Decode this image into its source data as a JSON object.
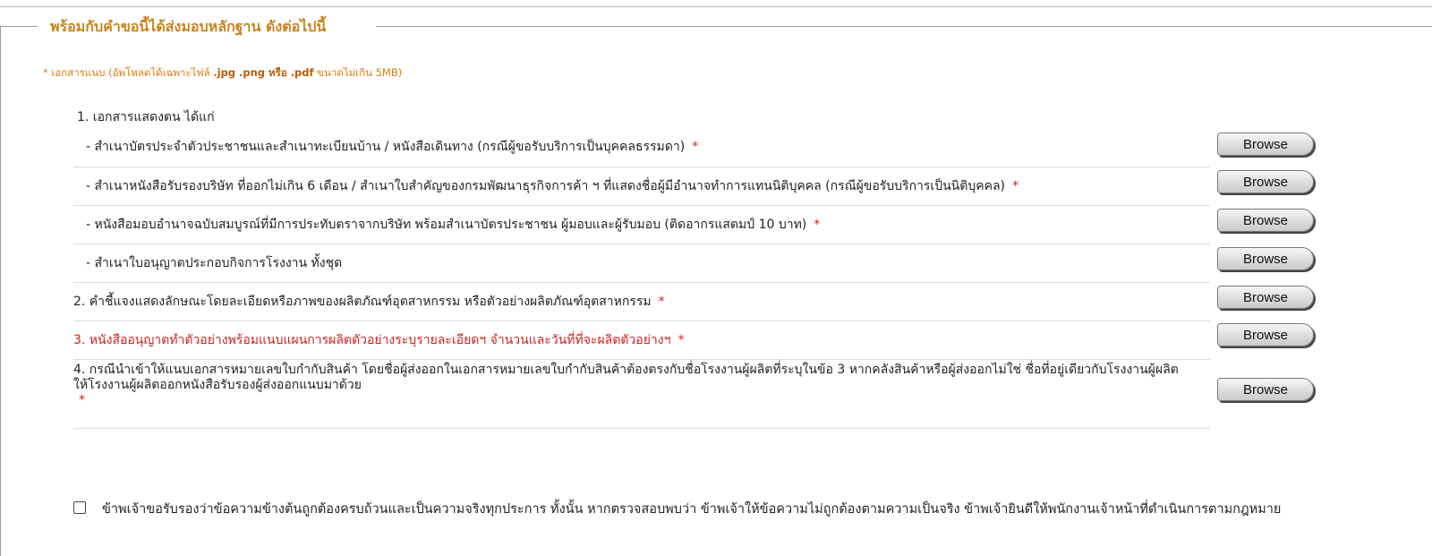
{
  "legend": "พร้อมกับคำขอนี้ได้ส่งมอบหลักฐาน ดังต่อไปนี้",
  "note": {
    "prefix": "* เอกสารแนบ (อัพโหลดได้เฉพาะไฟล์ ",
    "types": ".jpg .png หรือ .pdf",
    "suffix": " ขนาดไม่เกิน 5MB)"
  },
  "section1_title": "1. เอกสารแสดงตน ได้แก่",
  "required_mark": "*",
  "browse_label": "Browse",
  "rows": [
    {
      "text": "- สำเนาบัตรประจำตัวประชาชนและสำเนาทะเบียนบ้าน / หนังสือเดินทาง (กรณีผู้ขอรับบริการเป็นบุคคลธรรมดา)",
      "required": true
    },
    {
      "text": "- สำเนาหนังสือรับรองบริษัท ที่ออกไม่เกิน 6 เดือน / สำเนาใบสำคัญของกรมพัฒนาธุรกิจการค้า ฯ ที่แสดงชื่อผู้มีอำนาจทำการแทนนิติบุคคล (กรณีผู้ขอรับบริการเป็นนิติบุคคล)",
      "required": true
    },
    {
      "text": "- หนังสือมอบอำนาจฉบับสมบูรณ์ที่มีการประทับตราจากบริษัท พร้อมสำเนาบัตรประชาชน ผู้มอบและผู้รับมอบ (ติดอากรแสตมป์ 10 บาท)",
      "required": true
    },
    {
      "text": "- สำเนาใบอนุญาตประกอบกิจการโรงงาน ทั้งชุด",
      "required": false
    },
    {
      "text": "2. คำชี้แจงแสดงลักษณะโดยละเอียดหรือภาพของผลิตภัณฑ์อุตสาหกรรม หรือตัวอย่างผลิตภัณฑ์อุตสาหกรรม",
      "required": true
    },
    {
      "text": "3. หนังสืออนุญาตทำตัวอย่างพร้อมแนบแผนการผลิตตัวอย่างระบุรายละเอียดฯ จำนวนและวันที่ที่จะผลิตตัวอย่างฯ",
      "required": true
    },
    {
      "text": "4. กรณีนำเข้าให้แนบเอกสารหมายเลขใบกำกับสินค้า โดยชื่อผู้ส่งออกในเอกสารหมายเลขใบกำกับสินค้าต้องตรงกับชื่อโรงงานผู้ผลิตที่ระบุในข้อ 3 หากคลังสินค้าหรือผู้ส่งออกไม่ใช่ ชื่อที่อยู่เดียวกับโรงงานผู้ผลิตให้โรงงานผู้ผลิตออกหนังสือรับรองผู้ส่งออกแนบมาด้วย",
      "required": true
    }
  ],
  "confirm_text": "ข้าพเจ้าขอรับรองว่าข้อความข้างต้นถูกต้องครบถ้วนและเป็นความจริงทุกประการ ทั้งนั้น หากตรวจสอบพบว่า ข้าพเจ้าให้ข้อความไม่ถูกต้องตามความเป็นจริง ข้าพเจ้ายินดีให้พนักงานเจ้าหน้าที่ดำเนินการตามกฎหมาย",
  "colors": {
    "legend": "#c8831f",
    "note": "#e07b10",
    "required": "#d32020",
    "highlight_row": "#cc2222"
  }
}
